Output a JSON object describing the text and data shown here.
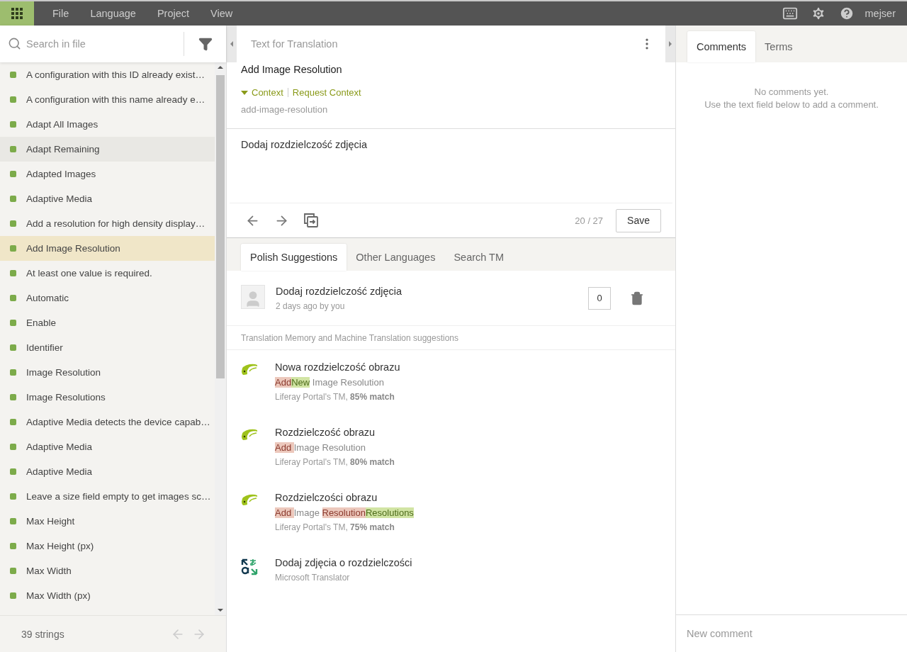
{
  "menu": {
    "items": [
      "File",
      "Language",
      "Project",
      "View"
    ],
    "user": "mejser"
  },
  "sidebar": {
    "search_placeholder": "Search in file",
    "count": "39 strings",
    "strings": [
      {
        "text": "A configuration with this ID already exist…",
        "selected": false,
        "hovered": false
      },
      {
        "text": "A configuration with this name already e…",
        "selected": false,
        "hovered": false
      },
      {
        "text": "Adapt All Images",
        "selected": false,
        "hovered": false
      },
      {
        "text": "Adapt Remaining",
        "selected": false,
        "hovered": true
      },
      {
        "text": "Adapted Images",
        "selected": false,
        "hovered": false
      },
      {
        "text": "Adaptive Media",
        "selected": false,
        "hovered": false
      },
      {
        "text": "Add a resolution for high density display…",
        "selected": false,
        "hovered": false
      },
      {
        "text": "Add Image Resolution",
        "selected": true,
        "hovered": false
      },
      {
        "text": "At least one value is required.",
        "selected": false,
        "hovered": false
      },
      {
        "text": "Automatic",
        "selected": false,
        "hovered": false
      },
      {
        "text": "Enable",
        "selected": false,
        "hovered": false
      },
      {
        "text": "Identifier",
        "selected": false,
        "hovered": false
      },
      {
        "text": "Image Resolution",
        "selected": false,
        "hovered": false
      },
      {
        "text": "Image Resolutions",
        "selected": false,
        "hovered": false
      },
      {
        "text": "Adaptive Media detects the device capab…",
        "selected": false,
        "hovered": false
      },
      {
        "text": "Adaptive Media",
        "selected": false,
        "hovered": false
      },
      {
        "text": "Adaptive Media",
        "selected": false,
        "hovered": false
      },
      {
        "text": "Leave a size field empty to get images sc…",
        "selected": false,
        "hovered": false
      },
      {
        "text": "Max Height",
        "selected": false,
        "hovered": false
      },
      {
        "text": "Max Height (px)",
        "selected": false,
        "hovered": false
      },
      {
        "text": "Max Width",
        "selected": false,
        "hovered": false
      },
      {
        "text": "Max Width (px)",
        "selected": false,
        "hovered": false
      }
    ]
  },
  "editor": {
    "heading": "Text for Translation",
    "source": "Add Image Resolution",
    "context_toggle": "Context",
    "context_expanded": true,
    "request_context": "Request Context",
    "key": "add-image-resolution",
    "translation": "Dodaj rozdzielczość zdjęcia",
    "progress": "20 / 27",
    "save": "Save"
  },
  "suggestion_tabs": [
    {
      "label": "Polish Suggestions",
      "selected": true
    },
    {
      "label": "Other Languages",
      "selected": false
    },
    {
      "label": "Search TM",
      "selected": false
    }
  ],
  "own_suggestion": {
    "text": "Dodaj rozdzielczość zdjęcia",
    "meta": "2 days ago by you",
    "votes": "0"
  },
  "section_label": "Translation Memory and Machine Translation suggestions",
  "suggestions": [
    {
      "kind": "tm",
      "text": "Nowa rozdzielczość obrazu",
      "diff": [
        {
          "kind": "removed",
          "text": "Add"
        },
        {
          "kind": "added",
          "text": "New"
        },
        {
          "kind": "same",
          "text": " Image Resolution"
        }
      ],
      "source": "Liferay Portal's TM, **85% match**"
    },
    {
      "kind": "tm",
      "text": "Rozdzielczość obrazu",
      "diff": [
        {
          "kind": "removed",
          "text": "Add "
        },
        {
          "kind": "same",
          "text": "Image Resolution"
        }
      ],
      "source": "Liferay Portal's TM, **80% match**"
    },
    {
      "kind": "tm",
      "text": "Rozdzielczości obrazu",
      "diff": [
        {
          "kind": "removed",
          "text": "Add "
        },
        {
          "kind": "same",
          "text": "Image "
        },
        {
          "kind": "removed",
          "text": "Resolution"
        },
        {
          "kind": "added",
          "text": "Resolutions"
        }
      ],
      "source": "Liferay Portal's TM, **75% match**"
    },
    {
      "kind": "mt",
      "text": "Dodaj zdjęcia o rozdzielczości",
      "source": "Microsoft Translator"
    }
  ],
  "side_tabs": [
    {
      "label": "Comments",
      "selected": true
    },
    {
      "label": "Terms",
      "selected": false
    }
  ],
  "comments": {
    "empty": [
      "No comments yet.",
      "Use the text field below to add a comment."
    ],
    "placeholder": "New comment"
  }
}
